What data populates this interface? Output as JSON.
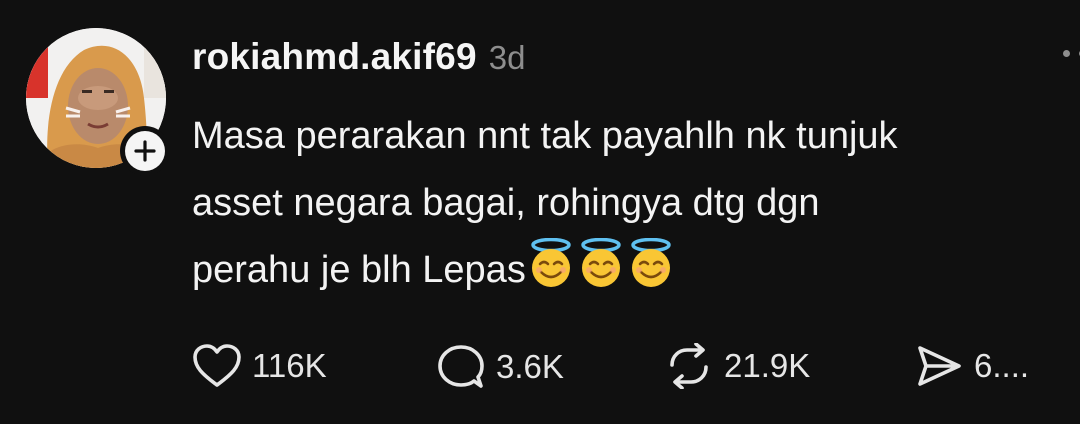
{
  "post": {
    "username": "rokiahmd.akif69",
    "timestamp": "3d",
    "text_lines": [
      "Masa perarakan nnt tak payahlh nk tunjuk",
      "asset negara bagai, rohingya dtg dgn",
      "perahu je blh Lepas"
    ],
    "emojis": [
      "smiling-face-with-halo",
      "smiling-face-with-halo",
      "smiling-face-with-halo"
    ]
  },
  "actions": {
    "likes": "116K",
    "replies": "3.6K",
    "reposts": "21.9K",
    "shares": "6...."
  },
  "icons": {
    "like": "heart-icon",
    "reply": "speech-bubble-icon",
    "repost": "repost-icon",
    "share": "send-icon",
    "follow": "plus-icon",
    "more": "more-dots-icon"
  },
  "colors": {
    "background": "#101010",
    "text": "#f3f3f3",
    "muted": "#8e8e8e"
  }
}
